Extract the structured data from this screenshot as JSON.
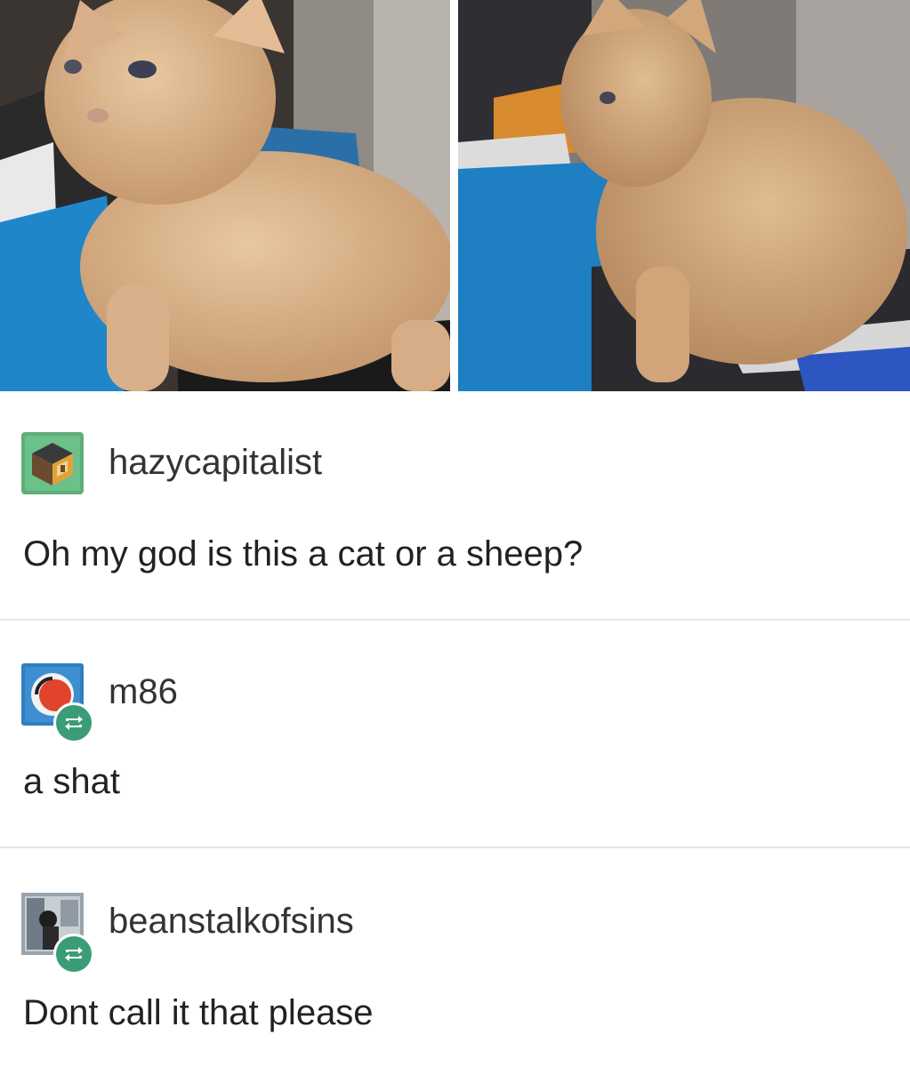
{
  "photos": [
    {
      "name": "curly-kitten-photo-1"
    },
    {
      "name": "curly-kitten-photo-2"
    }
  ],
  "posts": [
    {
      "username": "hazycapitalist",
      "text": "Oh my god is this a cat or a sheep?",
      "avatar_icon": "box-avatar",
      "reblog": false
    },
    {
      "username": "m86",
      "text": "a shat",
      "avatar_icon": "red-face-avatar",
      "reblog": true
    },
    {
      "username": "beanstalkofsins",
      "text": "Dont call it that please",
      "avatar_icon": "photo-avatar",
      "reblog": true
    }
  ],
  "colors": {
    "reblog_badge": "#3a9d76",
    "divider": "#e6e6e6",
    "text": "#222222"
  }
}
